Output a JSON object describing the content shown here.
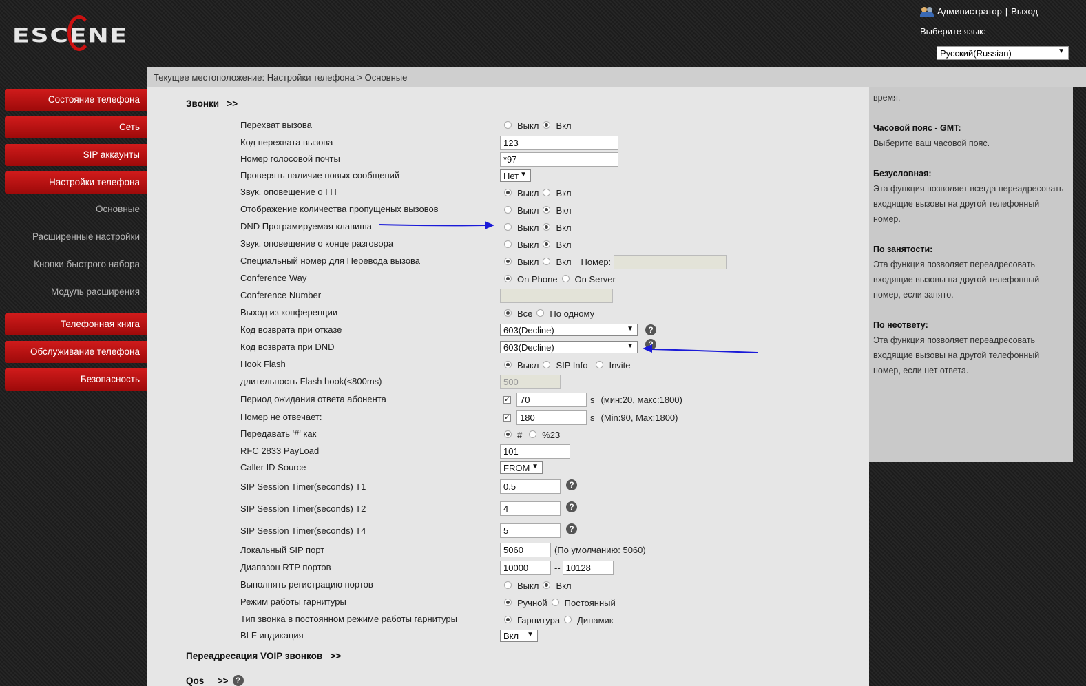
{
  "header": {
    "logo": "ESCENE",
    "user": "Администратор",
    "separator": "|",
    "logout": "Выход",
    "lang_label": "Выберите язык:",
    "lang_value": "Русский(Russian)"
  },
  "breadcrumb": "Текущее местоположение: Настройки телефона > Основные",
  "nav": {
    "phone_status": "Состояние телефона",
    "network": "Сеть",
    "sip_accounts": "SIP аккаунты",
    "phone_settings": "Настройки телефона",
    "basic": "Основные",
    "advanced": "Расширенные настройки",
    "speed_dial": "Кнопки быстрого набора",
    "ext_module": "Модуль расширения",
    "phonebook": "Телефонная книга",
    "maintenance": "Обслуживание телефона",
    "security": "Безопасность"
  },
  "sections": {
    "calls": "Звонки",
    "voip_forward": "Переадресация VOIP звонков",
    "qos": "Qos",
    "more": ">>"
  },
  "labels": {
    "off": "Выкл",
    "on": "Вкл",
    "number": "Номер:",
    "on_phone": "On Phone",
    "on_server": "On Server",
    "all": "Все",
    "one_by_one": "По одному",
    "sip_info": "SIP Info",
    "invite": "Invite",
    "s": "s",
    "hash": "#",
    "pct23": "%23",
    "dash": "--",
    "manual": "Ручной",
    "permanent": "Постоянный",
    "headset": "Гарнитура",
    "speaker": "Динамик"
  },
  "rows": {
    "call_pickup": "Перехват вызова",
    "pickup_code": "Код перехвата вызова",
    "voicemail_number": "Номер голосовой почты",
    "check_messages": "Проверять наличие новых сообщений",
    "sound_gp": "Звук. оповещение о ГП",
    "missed_count": "Отображение количества пропущеных вызовов",
    "dnd_key": "DND Програмируемая клавиша",
    "end_call_sound": "Звук. оповещение о конце разговора",
    "transfer_number": "Специальный номер для Перевода вызова",
    "conference_way": "Conference Way",
    "conference_number": "Conference Number",
    "conference_exit": "Выход из конференции",
    "reject_code": "Код возврата при отказе",
    "dnd_code": "Код возврата при DND",
    "hook_flash": "Hook Flash",
    "flash_duration": "длительность Flash hook(<800ms)",
    "answer_wait": "Период ожидания ответа абонента",
    "no_answer": "Номер не отвечает:",
    "send_hash": "Передавать '#' как",
    "rfc2833": "RFC 2833 PayLoad",
    "caller_id_source": "Caller ID Source",
    "t1": "SIP Session Timer(seconds) T1",
    "t2": "SIP Session Timer(seconds) T2",
    "t4": "SIP Session Timer(seconds) T4",
    "local_sip_port": "Локальный SIP порт",
    "rtp_range": "Диапазон RTP портов",
    "port_reg": "Выполнять регистрацию портов",
    "headset_mode": "Режим работы гарнитуры",
    "ring_type": "Тип звонка в постоянном режиме работы гарнитуры",
    "blf": "BLF индикация"
  },
  "values": {
    "pickup_code": "123",
    "voicemail_number": "*97",
    "check_messages": "Нет",
    "reject_code": "603(Decline)",
    "dnd_code": "603(Decline)",
    "flash_duration": "500",
    "answer_wait": "70",
    "answer_wait_hint": "(мин:20, макс:1800)",
    "no_answer": "180",
    "no_answer_hint": "(Min:90, Max:1800)",
    "rfc2833": "101",
    "caller_id_source": "FROM",
    "t1": "0.5",
    "t2": "4",
    "t4": "5",
    "local_sip_port": "5060",
    "local_sip_port_hint": "(По умолчанию: 5060)",
    "rtp_from": "10000",
    "rtp_to": "10128",
    "blf": "Вкл"
  },
  "help": {
    "top_text": "время.",
    "tz_title": "Часовой пояс - GMT:",
    "tz_text": "Выберите ваш часовой пояс.",
    "uncond_title": "Безусловная:",
    "uncond_text": "Эта функция позволяет всегда переадресовать входящие вызовы на другой телефонный номер.",
    "busy_title": "По занятости:",
    "busy_text": "Эта функция позволяет переадресовать входящие вызовы на другой телефонный номер, если занято.",
    "noans_title": "По неответу:",
    "noans_text": "Эта функция позволяет переадресовать входящие вызовы на другой телефонный номер, если нет ответа."
  },
  "colors": {
    "nav_red": "#c41414",
    "arrow_blue": "#1a1ad8",
    "panel_bg": "#e6e6e6"
  }
}
